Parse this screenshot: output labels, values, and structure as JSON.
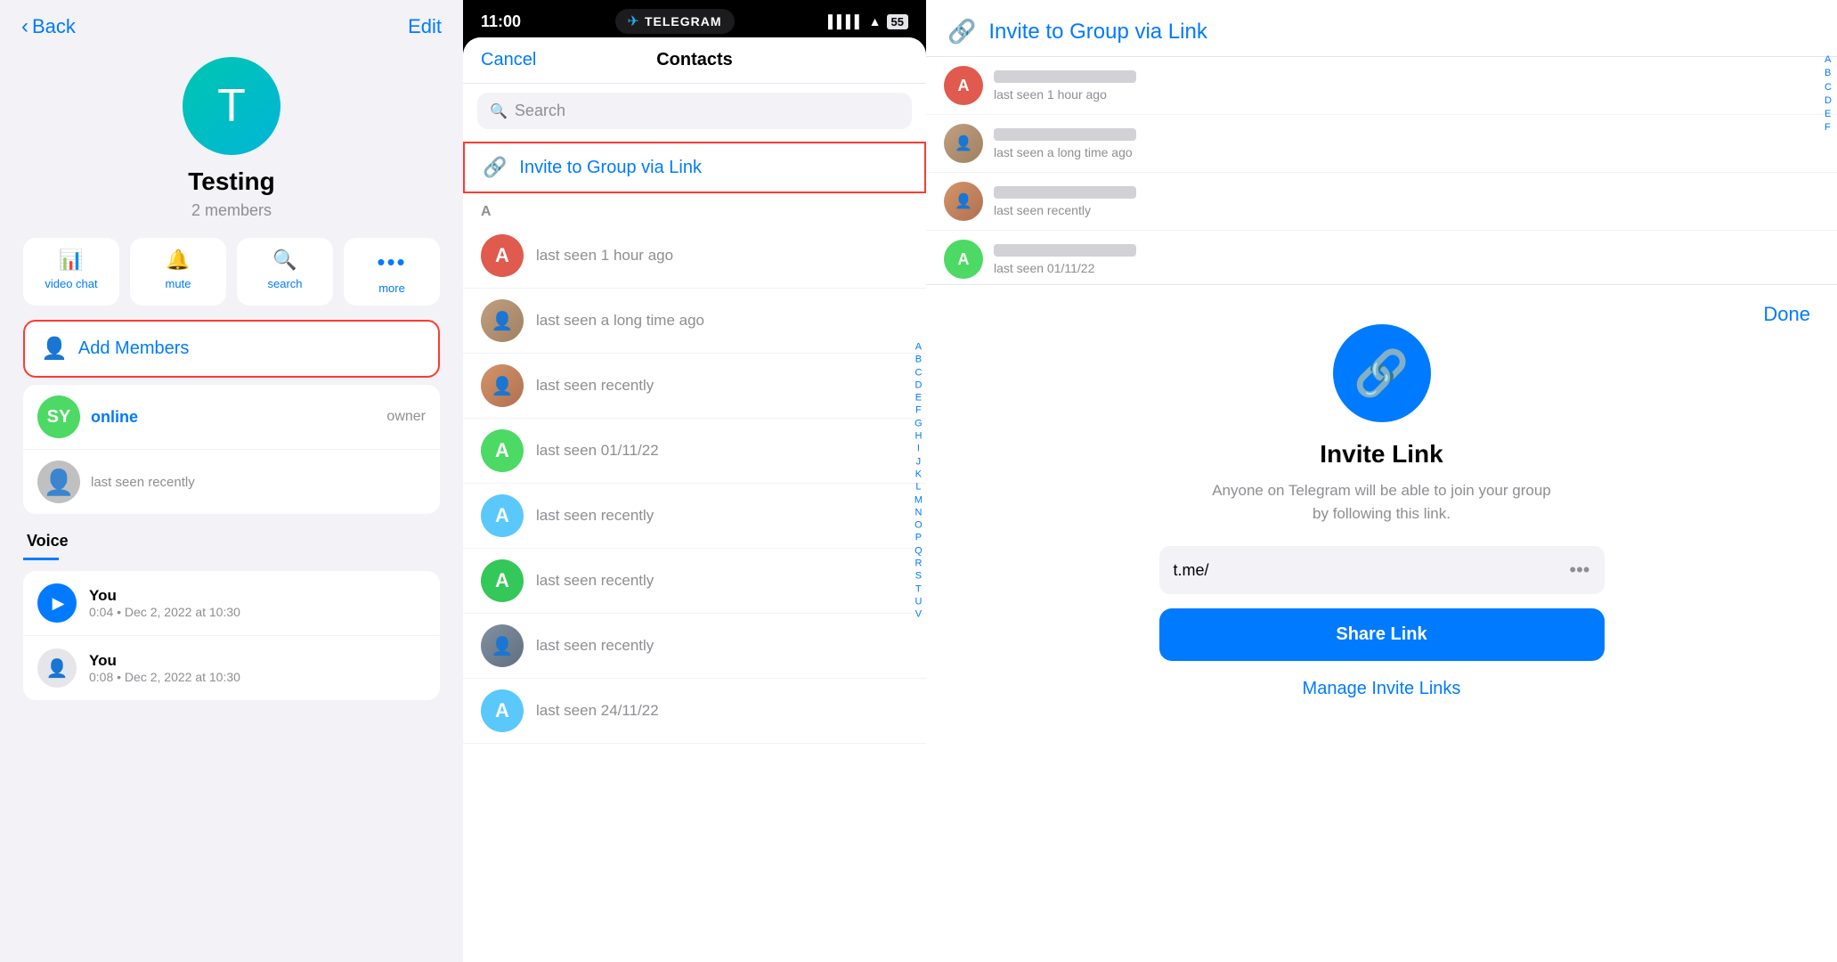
{
  "left": {
    "back_label": "Back",
    "edit_label": "Edit",
    "group_avatar_letter": "T",
    "group_name": "Testing",
    "group_members": "2 members",
    "action_buttons": [
      {
        "id": "video-chat",
        "icon": "📊",
        "label": "video chat"
      },
      {
        "id": "mute",
        "icon": "🔔",
        "label": "mute"
      },
      {
        "id": "search",
        "icon": "🔍",
        "label": "search"
      },
      {
        "id": "more",
        "icon": "···",
        "label": "more"
      }
    ],
    "add_members_label": "Add Members",
    "members": [
      {
        "id": "sy",
        "initials": "SY",
        "name": "SY",
        "status": "online",
        "role": "owner",
        "avatar_class": "sy"
      },
      {
        "id": "user2",
        "initials": "",
        "status": "last seen recently",
        "role": "",
        "avatar_class": "photo"
      }
    ],
    "voice_section_label": "Voice",
    "voice_items": [
      {
        "id": "voice1",
        "name": "You",
        "meta": "0:04 • Dec 2, 2022 at 10:30",
        "type": "play"
      },
      {
        "id": "voice2",
        "name": "You",
        "meta": "0:08 • Dec 2, 2022 at 10:30",
        "type": "thumb"
      }
    ]
  },
  "middle": {
    "time": "11:00",
    "app_name": "TELEGRAM",
    "cancel_label": "Cancel",
    "sheet_title": "Contacts",
    "search_placeholder": "Search",
    "invite_link_label": "Invite to Group via Link",
    "section_a": "A",
    "contacts": [
      {
        "id": "c1",
        "avatar_color": "#e05a4e",
        "avatar_letter": "A",
        "status": "last seen 1 hour ago"
      },
      {
        "id": "c2",
        "avatar_class": "photo-avatar-1",
        "status": "last seen a long time ago"
      },
      {
        "id": "c3",
        "avatar_class": "photo-avatar-2",
        "status": "last seen recently"
      },
      {
        "id": "c4",
        "avatar_color": "#4cd964",
        "avatar_letter": "A",
        "status": "last seen 01/11/22"
      },
      {
        "id": "c5",
        "avatar_color": "#5ac8fa",
        "avatar_letter": "A",
        "status": "last seen recently"
      },
      {
        "id": "c6",
        "avatar_color": "#34c759",
        "avatar_letter": "A",
        "status": "last seen recently"
      },
      {
        "id": "c7",
        "avatar_class": "photo-avatar-3",
        "status": "last seen recently"
      },
      {
        "id": "c8",
        "avatar_color": "#5ac8fa",
        "avatar_letter": "A",
        "status": "last seen 24/11/22"
      },
      {
        "id": "c9",
        "avatar_class": "photo-avatar-4",
        "status": ""
      }
    ],
    "alphabet": [
      "A",
      "B",
      "C",
      "D",
      "E",
      "F",
      "G",
      "H",
      "I",
      "J",
      "K",
      "L",
      "M",
      "N",
      "O",
      "P",
      "Q",
      "R",
      "S",
      "T",
      "U",
      "V"
    ]
  },
  "right": {
    "invite_link_title": "Invite to Group via Link",
    "done_label": "Done",
    "contacts_top": [
      {
        "id": "r1",
        "avatar_color": "#e05a4e",
        "avatar_letter": "A",
        "status": "last seen 1 hour ago"
      },
      {
        "id": "r2",
        "avatar_class": "photo-avatar-1",
        "status": "last seen a long time ago"
      },
      {
        "id": "r3",
        "avatar_class": "photo-avatar-2",
        "status": "last seen recently"
      },
      {
        "id": "r4",
        "avatar_color": "#4cd964",
        "avatar_letter": "A",
        "status": "last seen 01/11/22"
      }
    ],
    "alphabet": [
      "A",
      "B",
      "C",
      "D",
      "E",
      "F"
    ],
    "invite_link_heading": "Invite Link",
    "invite_link_desc": "Anyone on Telegram will be able to join your group by following this link.",
    "link_value": "t.me/",
    "share_link_label": "Share Link",
    "manage_links_label": "Manage Invite Links"
  }
}
